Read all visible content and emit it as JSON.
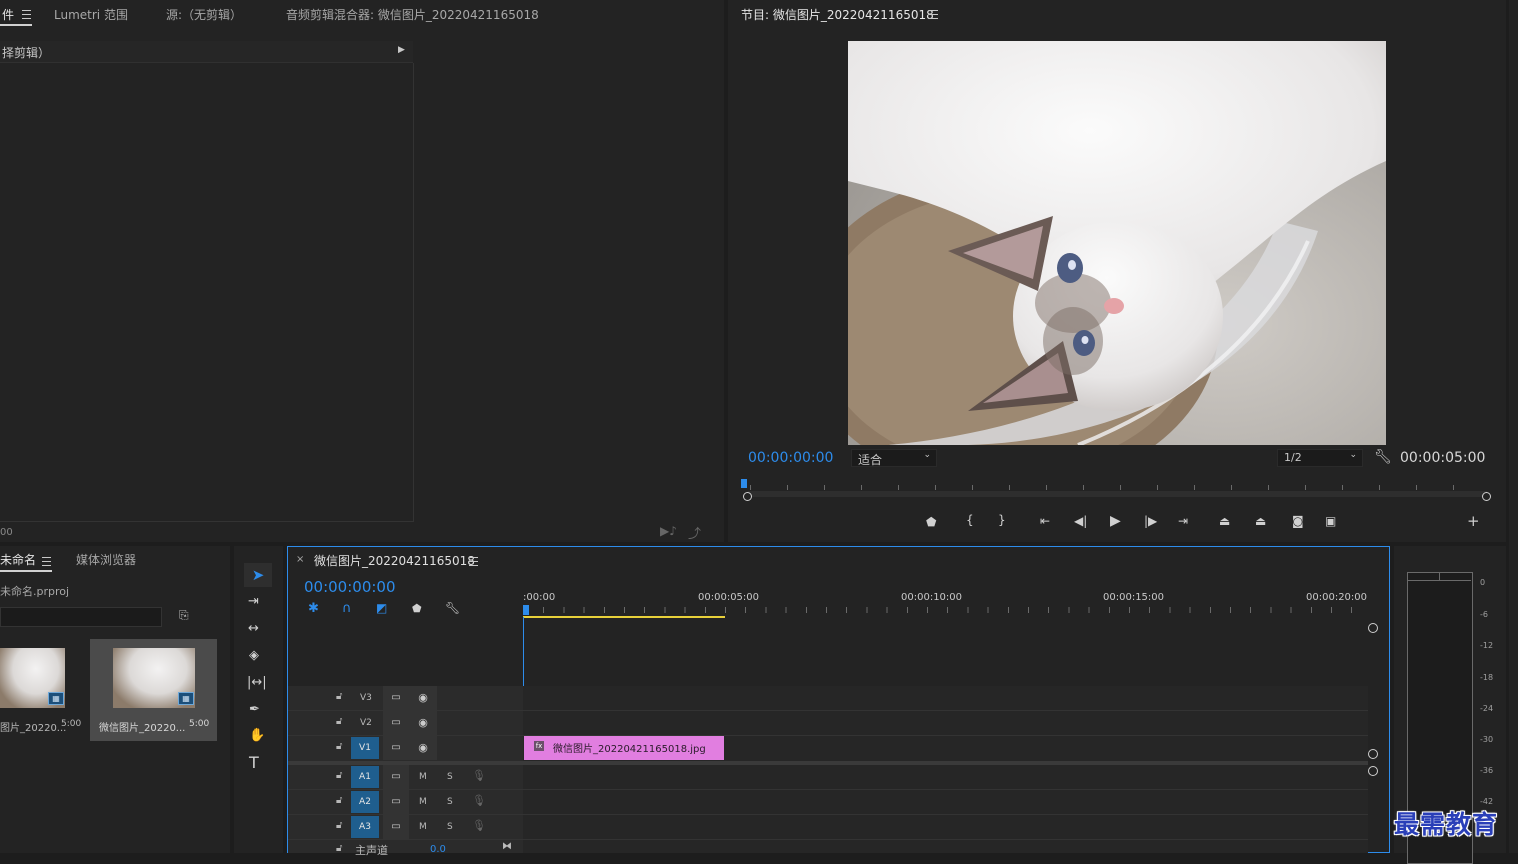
{
  "source_panel": {
    "tabs": [
      "件",
      "Lumetri 范围",
      "源:（无剪辑）",
      "音频剪辑混合器: 微信图片_20220421165018"
    ],
    "clip_selector": "择剪辑）",
    "timecode": "00"
  },
  "program_panel": {
    "title": "节目: 微信图片_20220421165018",
    "current_time": "00:00:00:00",
    "fit_label": "适合",
    "resolution": "1/2",
    "duration": "00:00:05:00"
  },
  "project_panel": {
    "tabs": [
      "未命名",
      "媒体浏览器"
    ],
    "project_file": "未命名.prproj",
    "items": [
      {
        "name": "图片_20220...",
        "duration": "5:00"
      },
      {
        "name": "微信图片_20220...",
        "duration": "5:00"
      }
    ]
  },
  "timeline": {
    "sequence_name": "微信图片_20220421165018",
    "close_label": "×",
    "timecode": "00:00:00:00",
    "ruler_labels": [
      ":00:00",
      "00:00:05:00",
      "00:00:10:00",
      "00:00:15:00",
      "00:00:20:00"
    ],
    "video_tracks": [
      "V3",
      "V2",
      "V1"
    ],
    "audio_tracks": [
      "A1",
      "A2",
      "A3"
    ],
    "master_label": "主声道",
    "master_value": "0.0",
    "mute_label": "M",
    "solo_label": "S",
    "clip_name": "微信图片_20220421165018.jpg"
  },
  "audio_meter": {
    "scale": [
      "0",
      "-6",
      "-12",
      "-18",
      "-24",
      "-30",
      "-36",
      "-42"
    ]
  },
  "watermark": "最需教育",
  "colors": {
    "accent": "#2d8ceb",
    "clip": "#e17ee0",
    "track_active": "#1f5e8e",
    "work_area": "#e8d03a"
  }
}
